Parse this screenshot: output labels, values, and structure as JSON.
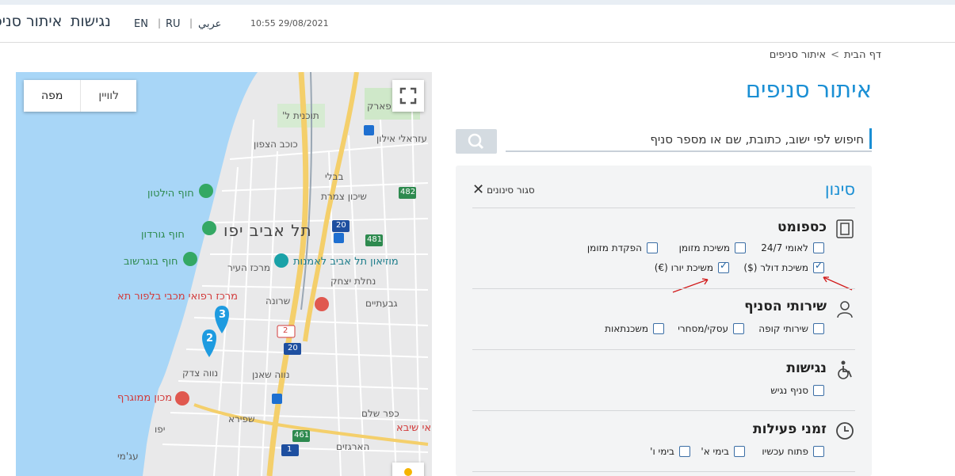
{
  "header": {
    "nav_branch_locator": "איתור סניפים",
    "nav_accessibility": "נגישות",
    "lang_en": "EN",
    "lang_ru": "RU",
    "lang_ar": "عربي",
    "separator": "|",
    "datetime": "10:55 29/08/2021"
  },
  "breadcrumb": {
    "home": "דף הבית",
    "arrow": ">",
    "current": "איתור סניפים"
  },
  "page": {
    "title": "איתור סניפים"
  },
  "search": {
    "placeholder": "חיפוש לפי ישוב, כתובת, שם או מספר סניף"
  },
  "map": {
    "btn_map": "מפה",
    "btn_satellite": "לוויין",
    "labels": {
      "luna_park": "לונה פארק",
      "tochnit_l": "תוכנית ל'",
      "ezraeli": "עזראלי אילון",
      "kochav_hatzafon": "כוכב הצפון",
      "bavli": "בבלי",
      "hilton": "חוף הילטון",
      "gordon": "חוף גורדון",
      "bograshov": "חוף בוגרשוב",
      "tel_aviv_yafo": "תל אביב יפו",
      "museum": "מוזיאון תל אביב לאמנות",
      "shikun_tzameret": "שיכון צמרת",
      "merkaz_hair": "מרכז העיר",
      "nahalat_yitzhak": "נחלת יצחק",
      "medical_center": "מרכז רפואי מכבי בלפור תא",
      "sharona": "שרונה",
      "givatayim": "גבעתיים",
      "neve_tzedek": "נווה צדק",
      "neve_shaanan": "נווה שאנן",
      "mamograf": "מכון ממוגרף",
      "shapira": "שפירא",
      "kfar_shalem": "כפר שלם",
      "yafo": "יפו",
      "sheba": "אי שיבא",
      "ajami": "עג'מי",
      "hargazim": "הארגזים",
      "road_482": "482",
      "road_481": "481",
      "road_461": "461",
      "road_20a": "20",
      "road_20b": "20",
      "road_2": "2",
      "road_1": "1",
      "pin_3": "3",
      "pin_2": "2"
    }
  },
  "filters": {
    "title": "סינון",
    "close_label": "סגור סינונים",
    "sections": {
      "cash": {
        "title": "כספומט",
        "options": [
          {
            "label": "לאומי 24/7",
            "checked": false
          },
          {
            "label": "משיכת מזומן",
            "checked": false
          },
          {
            "label": "הפקדת מזומן",
            "checked": false
          },
          {
            "label": "משיכת דולר ($)",
            "checked": true
          },
          {
            "label": "משיכת יורו (€)",
            "checked": true
          }
        ]
      },
      "services": {
        "title": "שירותי הסניף",
        "options": [
          {
            "label": "שירותי קופה",
            "checked": false
          },
          {
            "label": "עסקי/מסחרי",
            "checked": false
          },
          {
            "label": "משכנתאות",
            "checked": false
          }
        ]
      },
      "accessibility": {
        "title": "נגישות",
        "options": [
          {
            "label": "סניף נגיש",
            "checked": false
          }
        ]
      },
      "hours": {
        "title": "זמני פעילות",
        "options": [
          {
            "label": "פתוח עכשיו",
            "checked": false
          },
          {
            "label": "בימי א'",
            "checked": false
          },
          {
            "label": "בימי ו'",
            "checked": false
          }
        ]
      }
    }
  },
  "colors": {
    "accent": "#1a8fd4",
    "sea": "#a8d6f7",
    "highway": "#f4cf6b",
    "pin": "#1e9be0",
    "annotation_arrow": "#d11a1a"
  }
}
